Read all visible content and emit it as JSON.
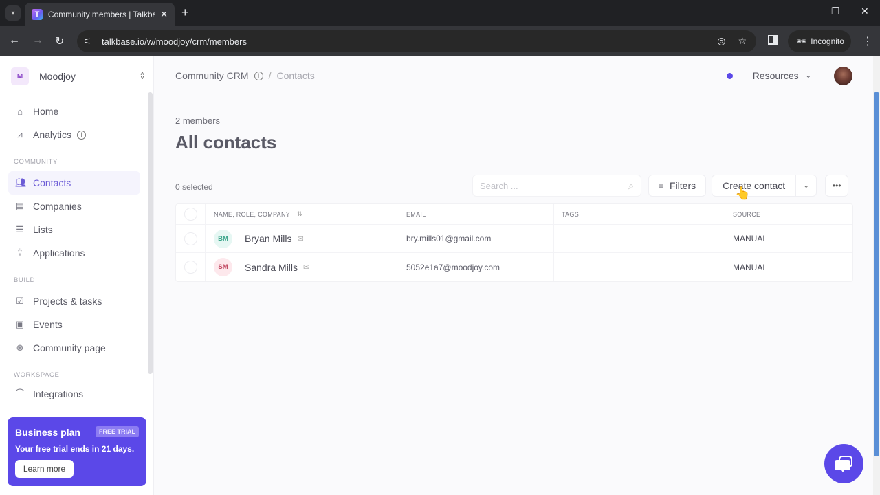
{
  "browser": {
    "tab_title": "Community members | Talkbase",
    "url": "talkbase.io/w/moodjoy/crm/members",
    "incognito_label": "Incognito",
    "favicon_letter": "T"
  },
  "sidebar": {
    "workspace": {
      "initial": "M",
      "name": "Moodjoy"
    },
    "top_items": [
      {
        "label": "Home",
        "icon": "home-icon"
      },
      {
        "label": "Analytics",
        "icon": "chart-icon"
      }
    ],
    "sections": [
      {
        "title": "COMMUNITY",
        "items": [
          {
            "label": "Contacts",
            "icon": "contacts-icon",
            "active": true
          },
          {
            "label": "Companies",
            "icon": "building-icon"
          },
          {
            "label": "Lists",
            "icon": "list-icon"
          },
          {
            "label": "Applications",
            "icon": "user-plus-icon"
          }
        ]
      },
      {
        "title": "BUILD",
        "items": [
          {
            "label": "Projects & tasks",
            "icon": "task-icon"
          },
          {
            "label": "Events",
            "icon": "calendar-icon"
          },
          {
            "label": "Community page",
            "icon": "globe-icon"
          }
        ]
      },
      {
        "title": "WORKSPACE",
        "items": [
          {
            "label": "Integrations",
            "icon": "plug-icon"
          }
        ]
      }
    ],
    "plan": {
      "title": "Business plan",
      "badge": "FREE TRIAL",
      "text": "Your free trial ends in 21 days.",
      "button": "Learn more"
    }
  },
  "header": {
    "breadcrumb_root": "Community CRM",
    "breadcrumb_sep": "/",
    "breadcrumb_current": "Contacts",
    "resources_label": "Resources"
  },
  "main": {
    "members_count": "2 members",
    "title": "All contacts",
    "selected_text": "0 selected",
    "search_placeholder": "Search ...",
    "filters_label": "Filters",
    "create_label": "Create contact",
    "table": {
      "columns": [
        "NAME, ROLE, COMPANY",
        "EMAIL",
        "TAGS",
        "SOURCE"
      ],
      "rows": [
        {
          "initials": "BM",
          "name": "Bryan Mills",
          "email": "bry.mills01@gmail.com",
          "tags": "",
          "source": "MANUAL",
          "avatar_bg": "#e6f7f3",
          "avatar_fg": "#3aa58a"
        },
        {
          "initials": "SM",
          "name": "Sandra Mills",
          "email": "5052e1a7@moodjoy.com",
          "tags": "",
          "source": "MANUAL",
          "avatar_bg": "#fde8ec",
          "avatar_fg": "#c24b64"
        }
      ]
    }
  },
  "colors": {
    "accent": "#5b48e8",
    "active_nav": "#6b5bd6"
  }
}
